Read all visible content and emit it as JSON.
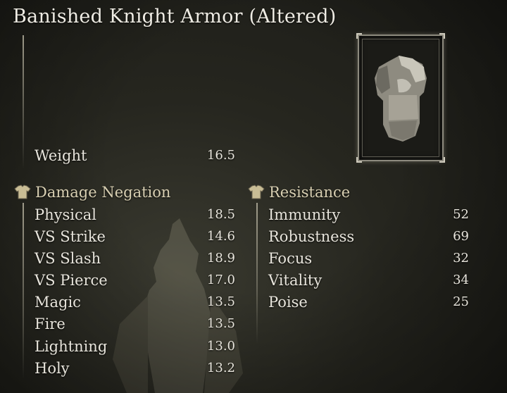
{
  "item_name": "Banished Knight Armor (Altered)",
  "weight": {
    "label": "Weight",
    "value": "16.5"
  },
  "damage_negation": {
    "heading": "Damage Negation",
    "icon": "armor-icon",
    "rows": [
      {
        "label": "Physical",
        "value": "18.5"
      },
      {
        "label": "VS Strike",
        "value": "14.6"
      },
      {
        "label": "VS Slash",
        "value": "18.9"
      },
      {
        "label": "VS Pierce",
        "value": "17.0"
      },
      {
        "label": "Magic",
        "value": "13.5"
      },
      {
        "label": "Fire",
        "value": "13.5"
      },
      {
        "label": "Lightning",
        "value": "13.0"
      },
      {
        "label": "Holy",
        "value": "13.2"
      }
    ]
  },
  "resistance": {
    "heading": "Resistance",
    "icon": "armor-icon",
    "rows": [
      {
        "label": "Immunity",
        "value": "52"
      },
      {
        "label": "Robustness",
        "value": "69"
      },
      {
        "label": "Focus",
        "value": "32"
      },
      {
        "label": "Vitality",
        "value": "34"
      },
      {
        "label": "Poise",
        "value": "25"
      }
    ]
  },
  "colors": {
    "text": "#e8e5dc",
    "heading": "#d8cfb2",
    "frame": "#8d8a7e"
  }
}
